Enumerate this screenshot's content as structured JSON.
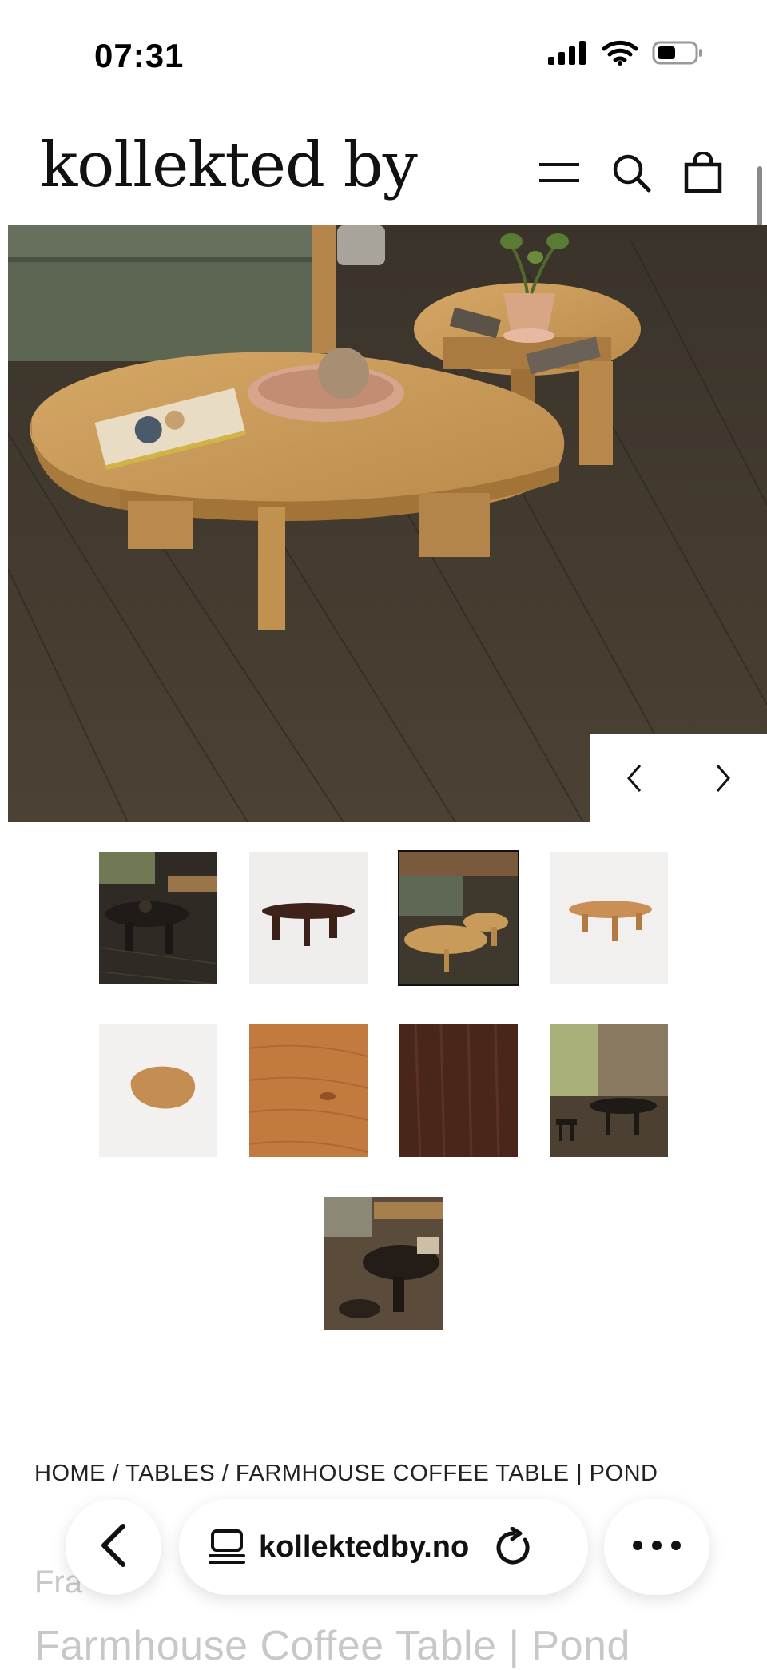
{
  "status_bar": {
    "time": "07:31",
    "icons": [
      "cellular-signal-icon",
      "wifi-icon",
      "battery-icon"
    ]
  },
  "header": {
    "logo_text": "kollekted by",
    "icons": [
      "hamburger-menu-icon",
      "search-icon",
      "shopping-bag-icon"
    ]
  },
  "gallery": {
    "main_image_alt": "Farmhouse Coffee Table Pond in oak, nested pair on a wooden floor",
    "prev_icon": "chevron-left-icon",
    "next_icon": "chevron-right-icon",
    "thumbnail_count": 9,
    "active_thumbnail": 3
  },
  "breadcrumb": {
    "items": [
      "HOME",
      "TABLES",
      "FARMHOUSE COFFEE TABLE | POND"
    ],
    "separator": "/"
  },
  "product": {
    "vendor_partial": "Fra",
    "title": "Farmhouse Coffee Table | Pond"
  },
  "browser": {
    "url": "kollektedby.no",
    "icons": [
      "back-chevron-icon",
      "tab-overview-icon",
      "reload-icon",
      "more-dots-icon"
    ]
  },
  "colors": {
    "accent_text": "#111111",
    "oak": "#c99b5a",
    "floor": "#3d3529",
    "sofa": "#5b6250"
  }
}
